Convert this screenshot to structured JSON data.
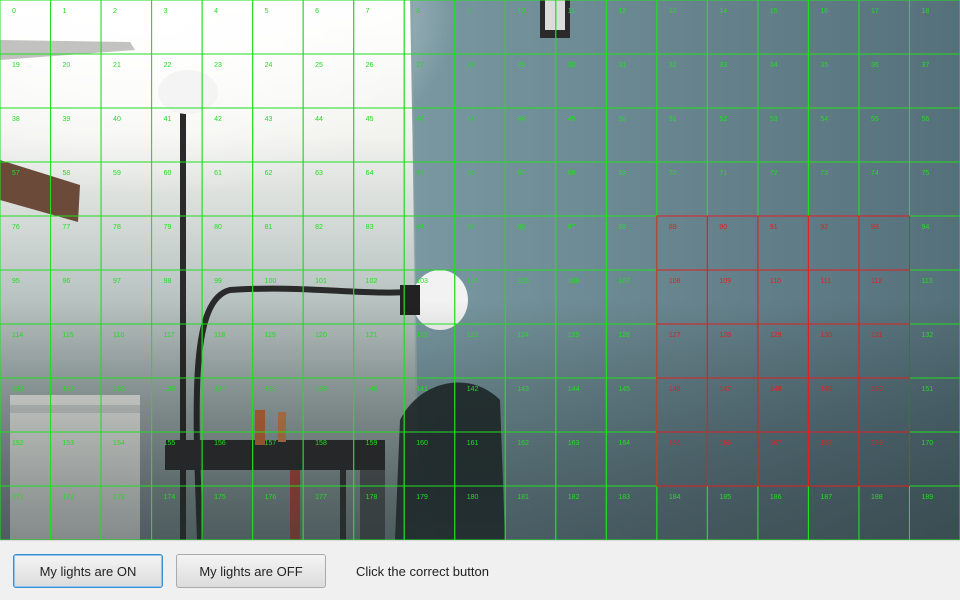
{
  "camera": {
    "grid_columns": 19,
    "grid_rows": 10,
    "cell_numbers_start": 0,
    "cell_numbers_end": 189,
    "grid_color": "#22dd22",
    "selected_color": "#dd2222",
    "selected_cells": [
      89,
      90,
      91,
      92,
      93,
      108,
      109,
      110,
      111,
      112,
      127,
      128,
      129,
      130,
      131,
      146,
      147,
      148,
      149,
      150,
      165,
      166,
      167,
      168,
      169
    ]
  },
  "toolbar": {
    "lights_on_label": "My lights are ON",
    "lights_off_label": "My lights are OFF",
    "instruction": "Click the correct button"
  },
  "colors": {
    "focus_border": "#3a8fd0",
    "toolbar_bg": "#f0f0f0"
  }
}
